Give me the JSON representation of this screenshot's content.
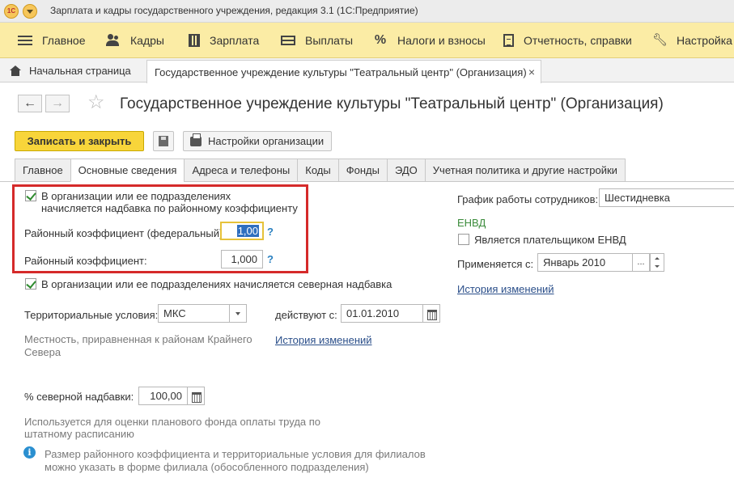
{
  "window": {
    "title": "Зарплата и кадры государственного учреждения, редакция 3.1  (1С:Предприятие)",
    "logo_text": "1С"
  },
  "sections": [
    {
      "label": "Главное",
      "icon": "menu-icon"
    },
    {
      "label": "Кадры",
      "icon": "people-icon"
    },
    {
      "label": "Зарплата",
      "icon": "calculator-icon"
    },
    {
      "label": "Выплаты",
      "icon": "money-icon"
    },
    {
      "label": "Налоги и взносы",
      "icon": "percent-icon"
    },
    {
      "label": "Отчетность, справки",
      "icon": "report-icon"
    },
    {
      "label": "Настройка",
      "icon": "wrench-icon"
    }
  ],
  "open_windows": {
    "home": "Начальная страница",
    "current": "Государственное учреждение культуры \"Театральный центр\" (Организация)",
    "close_glyph": "×"
  },
  "form": {
    "title": "Государственное учреждение культуры \"Театральный центр\" (Организация)",
    "back_glyph": "←",
    "forward_glyph": "→",
    "star_glyph": "☆",
    "save_close": "Записать и закрыть",
    "org_settings": "Настройки организации"
  },
  "tabs": [
    "Главное",
    "Основные сведения",
    "Адреса и телефоны",
    "Коды",
    "Фонды",
    "ЭДО",
    "Учетная политика и другие настройки"
  ],
  "active_tab": "Основные сведения",
  "content": {
    "regional_coeff_check": {
      "line1": "В организации или ее подразделениях",
      "line2": "начисляется надбавка по районному коэффициенту",
      "checked": true
    },
    "federal_coeff_label": "Районный коэффициент (федеральный):",
    "federal_coeff_value": "1,00",
    "coeff_label": "Районный коэффициент:",
    "coeff_value": "1,000",
    "help_glyph": "?",
    "northern_check": {
      "label": "В организации или ее подразделениях начисляется северная надбавка",
      "checked": true
    },
    "territorial_label": "Территориальные условия:",
    "territorial_value": "МКС",
    "valid_from_label": "действуют с:",
    "valid_from_value": "01.01.2010",
    "locality_note_line1": "Местность, приравненная к районам Крайнего",
    "locality_note_line2": "Севера",
    "history_link_left": "История изменений",
    "northern_pct_label": "% северной надбавки:",
    "northern_pct_value": "100,00",
    "usage_note_line1": "Используется для оценки планового фонда оплаты труда по",
    "usage_note_line2": "штатному расписанию",
    "info_glyph": "i",
    "info_line1": "Размер районного коэффициента и территориальные условия для филиалов",
    "info_line2": "можно указать в форме филиала (обособленного подразделения)",
    "schedule_label": "График работы сотрудников:",
    "schedule_value": "Шестидневка",
    "envd_heading": "ЕНВД",
    "envd_check": {
      "label": "Является плательщиком ЕНВД",
      "checked": false
    },
    "applies_from_label": "Применяется с:",
    "applies_from_value": "Январь 2010",
    "ellipsis_glyph": "...",
    "history_link_right": "История изменений"
  },
  "colors": {
    "section_panel": "#fbeca5",
    "save_button": "#f8d53a",
    "highlight_frame": "#d52a2a",
    "focus_border": "#e6c23a",
    "link": "#2b4f8a",
    "envd_heading": "#3c8c3c",
    "help": "#2a80c0"
  }
}
